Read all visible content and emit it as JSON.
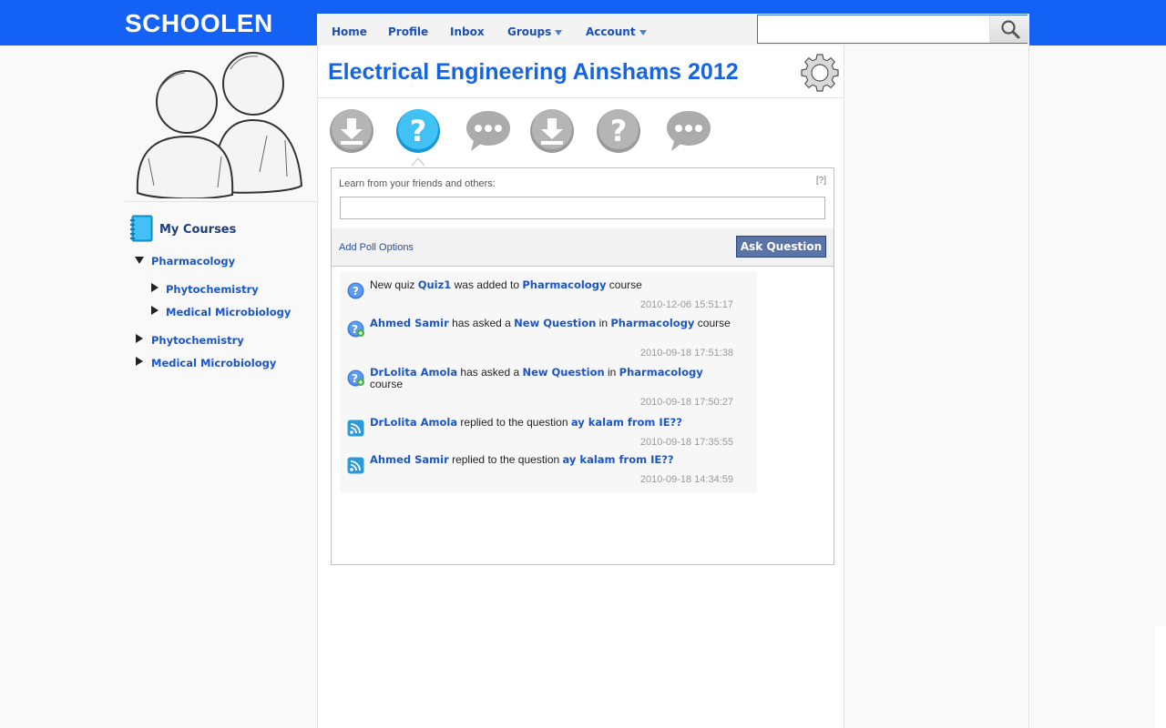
{
  "brand": {
    "logo_text": "SCHOOLEN",
    "topbar_color": "#1361f5"
  },
  "nav": {
    "items": [
      {
        "label": "Home",
        "has_dropdown": false
      },
      {
        "label": "Profile",
        "has_dropdown": false
      },
      {
        "label": "Inbox",
        "has_dropdown": false
      },
      {
        "label": "Groups",
        "has_dropdown": true
      },
      {
        "label": "Account",
        "has_dropdown": true
      }
    ]
  },
  "search": {
    "value": "",
    "placeholder": "",
    "icon": "magnifier-icon"
  },
  "sidebar": {
    "courses_title": "My Courses",
    "tree": [
      {
        "label": "Pharmacology",
        "expanded": true,
        "level": 0
      },
      {
        "label": "Phytochemistry",
        "expanded": false,
        "level": 1
      },
      {
        "label": "Medical Microbiology",
        "expanded": false,
        "level": 1
      },
      {
        "label": "Phytochemistry",
        "expanded": false,
        "level": 0
      },
      {
        "label": "Medical Microbiology",
        "expanded": false,
        "level": 0
      }
    ]
  },
  "main": {
    "title": "Electrical Engineering Ainshams 2012",
    "toolbar": [
      {
        "icon": "download-icon",
        "active": false
      },
      {
        "icon": "question-icon",
        "active": true
      },
      {
        "icon": "chat-bubble-icon",
        "active": false
      },
      {
        "icon": "download-icon",
        "active": false
      },
      {
        "icon": "question-icon",
        "active": false
      },
      {
        "icon": "chat-bubble-icon",
        "active": false
      }
    ],
    "ask": {
      "prompt": "Learn from your friends and others:",
      "help": "[?]",
      "question_value": "",
      "poll_link": "Add Poll Options",
      "button": "Ask Question"
    },
    "feed": [
      {
        "icon": "question-icon",
        "parts": [
          {
            "t": "New quiz ",
            "link": false
          },
          {
            "t": "Quiz1",
            "link": true
          },
          {
            "t": " was added to ",
            "link": false
          },
          {
            "t": "Pharmacology",
            "link": true
          },
          {
            "t": " course",
            "link": false
          }
        ],
        "time": "2010-12-06 15:51:17"
      },
      {
        "icon": "question-add-icon",
        "parts": [
          {
            "t": "Ahmed Samir",
            "link": true
          },
          {
            "t": " has asked a ",
            "link": false
          },
          {
            "t": "New Question",
            "link": true
          },
          {
            "t": " in ",
            "link": false
          },
          {
            "t": "Pharmacology",
            "link": true
          },
          {
            "t": " course",
            "link": false
          }
        ],
        "time": "2010-09-18 17:51:38"
      },
      {
        "icon": "question-add-icon",
        "parts": [
          {
            "t": "DrLolita Amola",
            "link": true
          },
          {
            "t": " has asked a ",
            "link": false
          },
          {
            "t": "New Question",
            "link": true
          },
          {
            "t": " in ",
            "link": false
          },
          {
            "t": "Pharmacology",
            "link": true
          },
          {
            "t": " course",
            "link": false
          }
        ],
        "time": "2010-09-18 17:50:27"
      },
      {
        "icon": "rss-icon",
        "parts": [
          {
            "t": "DrLolita Amola",
            "link": true
          },
          {
            "t": " replied to the question ",
            "link": false
          },
          {
            "t": "ay kalam from IE??",
            "link": true
          }
        ],
        "time": "2010-09-18 17:35:55"
      },
      {
        "icon": "rss-icon",
        "parts": [
          {
            "t": "Ahmed Samir",
            "link": true
          },
          {
            "t": " replied to the question ",
            "link": false
          },
          {
            "t": "ay kalam from IE??",
            "link": true
          }
        ],
        "time": "2010-09-18 14:34:59"
      }
    ]
  }
}
